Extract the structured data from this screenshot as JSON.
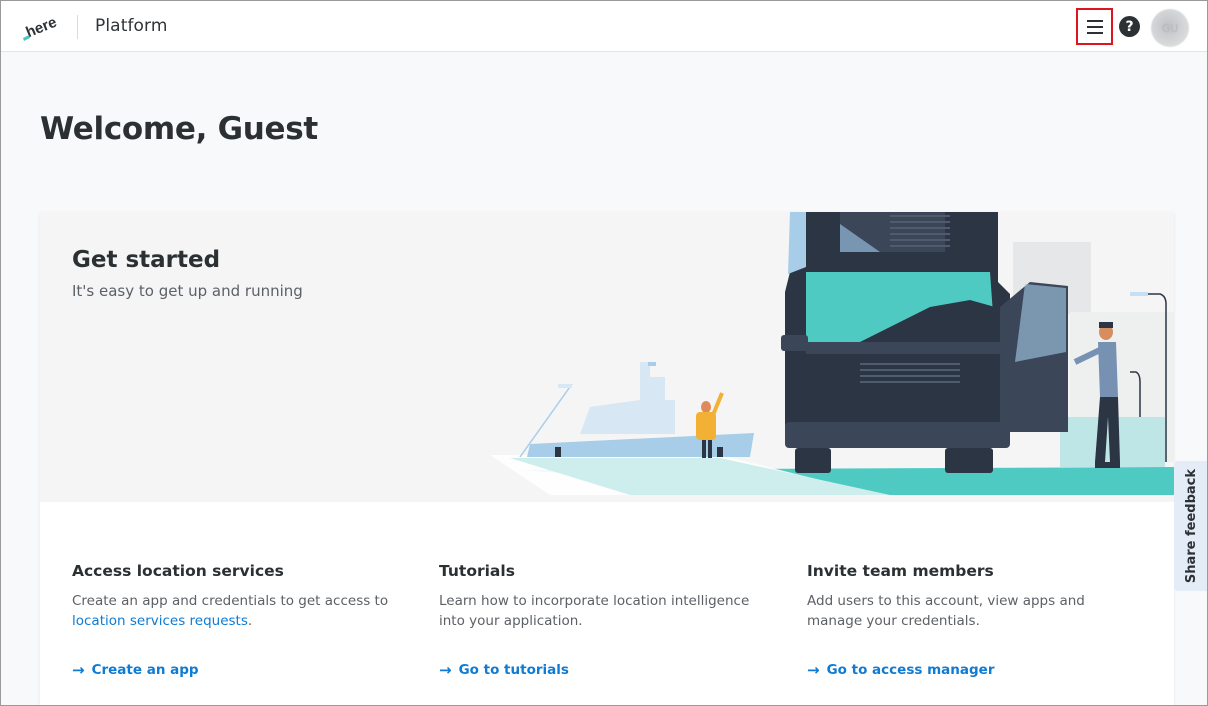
{
  "header": {
    "logo_text": "here",
    "title": "Platform",
    "menu_icon": "hamburger-icon",
    "help_icon": "help-icon",
    "help_glyph": "?",
    "avatar_initials": "GU"
  },
  "welcome": {
    "heading": "Welcome, Guest"
  },
  "hero": {
    "title": "Get started",
    "subtitle": "It's easy to get up and running"
  },
  "columns": [
    {
      "title": "Access location services",
      "desc_prefix": "Create an app and credentials to get access to ",
      "desc_link": "location services requests",
      "desc_suffix": ".",
      "action": "Create an app"
    },
    {
      "title": "Tutorials",
      "desc_prefix": "Learn how to incorporate location intelligence into your application.",
      "desc_link": "",
      "desc_suffix": "",
      "action": "Go to tutorials"
    },
    {
      "title": "Invite team members",
      "desc_prefix": "Add users to this account, view apps and manage your credentials.",
      "desc_link": "",
      "desc_suffix": "",
      "action": "Go to access manager"
    }
  ],
  "feedback": {
    "label": "Share feedback"
  },
  "colors": {
    "accent_link": "#0f7bd2",
    "menu_highlight": "#e0141e",
    "teal": "#48c8c1",
    "dark": "#2c3544"
  },
  "arrow_glyph": "→"
}
